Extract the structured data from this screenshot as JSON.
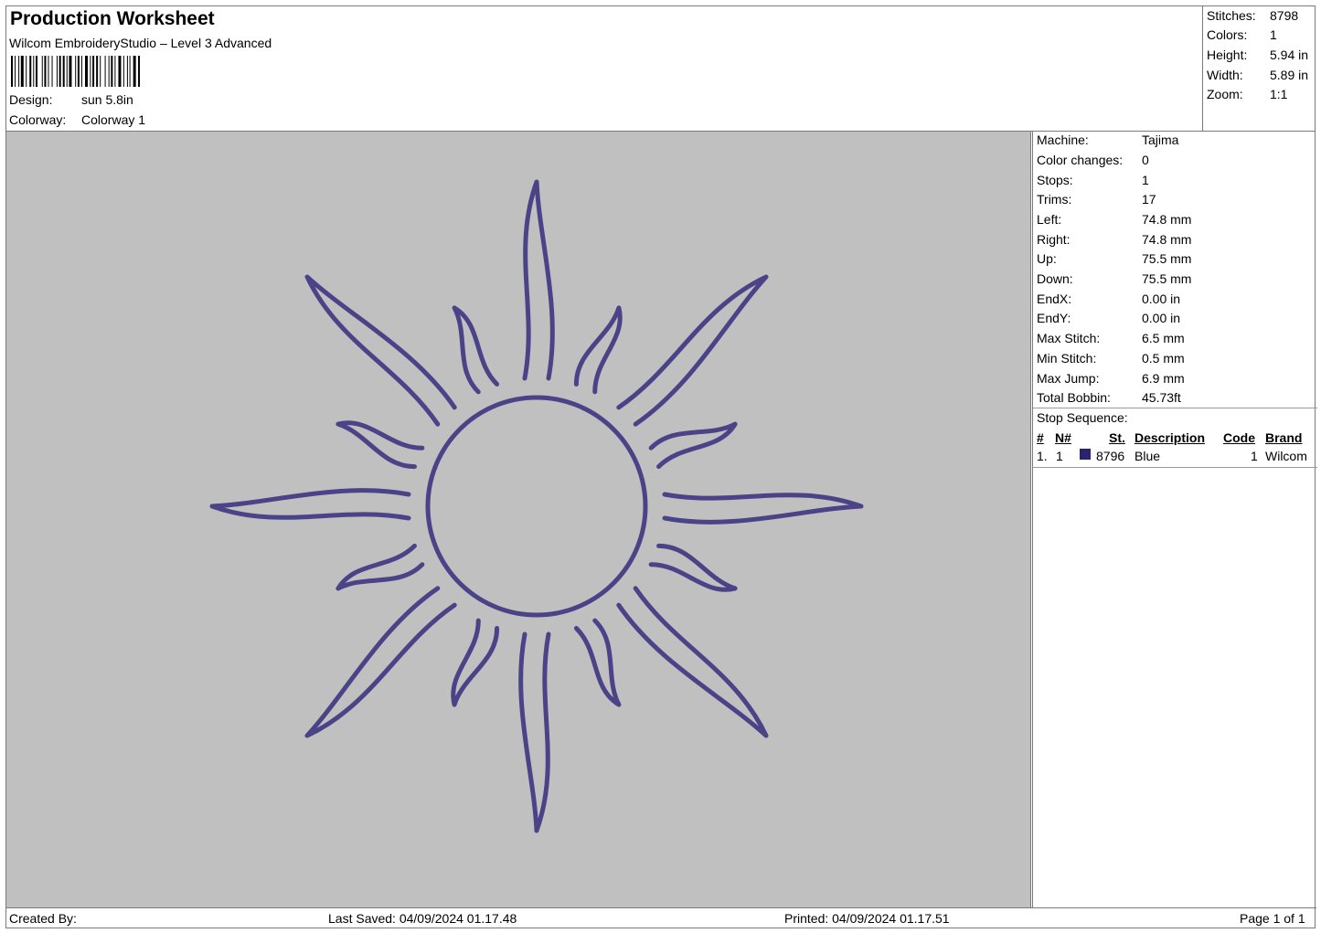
{
  "header": {
    "title": "Production Worksheet",
    "subtitle": "Wilcom EmbroideryStudio – Level 3 Advanced",
    "design_label": "Design:",
    "design_value": "sun 5.8in",
    "colorway_label": "Colorway:",
    "colorway_value": "Colorway 1"
  },
  "summary": [
    {
      "label": "Stitches:",
      "value": "8798"
    },
    {
      "label": "Colors:",
      "value": "1"
    },
    {
      "label": "Height:",
      "value": "5.94 in"
    },
    {
      "label": "Width:",
      "value": "5.89 in"
    },
    {
      "label": "Zoom:",
      "value": "1:1"
    }
  ],
  "specs": [
    {
      "label": "Machine:",
      "value": "Tajima"
    },
    {
      "label": "Color changes:",
      "value": "0"
    },
    {
      "label": "Stops:",
      "value": "1"
    },
    {
      "label": "Trims:",
      "value": "17"
    },
    {
      "label": "Left:",
      "value": "74.8 mm"
    },
    {
      "label": "Right:",
      "value": "74.8 mm"
    },
    {
      "label": "Up:",
      "value": "75.5 mm"
    },
    {
      "label": "Down:",
      "value": "75.5 mm"
    },
    {
      "label": "EndX:",
      "value": "0.00 in"
    },
    {
      "label": "EndY:",
      "value": "0.00 in"
    },
    {
      "label": "Max Stitch:",
      "value": "6.5 mm"
    },
    {
      "label": "Min Stitch:",
      "value": "0.5 mm"
    },
    {
      "label": "Max Jump:",
      "value": "6.9 mm"
    },
    {
      "label": "Total Bobbin:",
      "value": "45.73ft"
    }
  ],
  "stop_sequence": {
    "title": "Stop Sequence:",
    "columns": {
      "num": "#",
      "n": "N#",
      "st": "St.",
      "description": "Description",
      "code": "Code",
      "brand": "Brand"
    },
    "rows": [
      {
        "num": "1.",
        "n": "1",
        "st": "8796",
        "description": "Blue",
        "code": "1",
        "brand": "Wilcom",
        "color": "#2a2470"
      }
    ]
  },
  "design": {
    "thread_color": "#4b4387",
    "background": "#c0c0c0"
  },
  "footer": {
    "created_by": "Created By:",
    "last_saved": "Last Saved: 04/09/2024 01.17.48",
    "printed": "Printed: 04/09/2024 01.17.51",
    "page": "Page 1 of 1"
  }
}
